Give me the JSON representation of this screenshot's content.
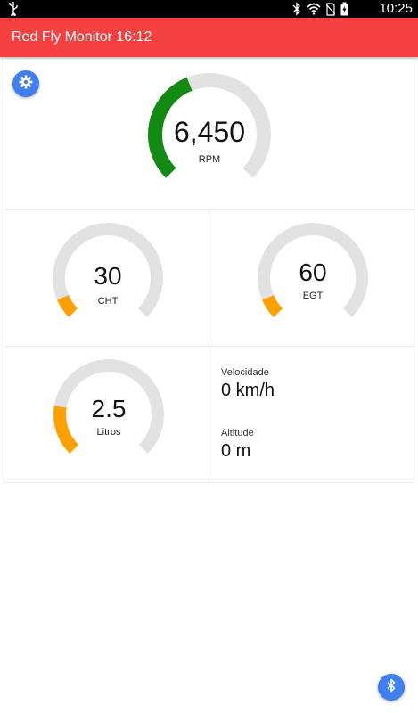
{
  "status_bar": {
    "time": "10:25",
    "icons": [
      "usb-icon",
      "bluetooth-icon",
      "wifi-icon",
      "no-sim-icon",
      "battery-charging-icon"
    ]
  },
  "app_bar": {
    "title": "Red Fly Monitor 16:12"
  },
  "colors": {
    "app_bar": "#f44040",
    "fab": "#3f7ff0",
    "gauge_track": "#e2e2e2",
    "rpm_arc": "#138a13",
    "orange_arc": "#ffa000"
  },
  "gauges": {
    "rpm": {
      "value": "6,450",
      "label": "RPM",
      "fill_fraction": 0.42
    },
    "cht": {
      "value": "30",
      "label": "CHT",
      "fill_fraction": 0.08
    },
    "egt": {
      "value": "60",
      "label": "EGT",
      "fill_fraction": 0.08
    },
    "fuel": {
      "value": "2.5",
      "label": "Litros",
      "fill_fraction": 0.2
    }
  },
  "info": {
    "speed": {
      "label": "Velocidade",
      "value": "0 km/h"
    },
    "altitude": {
      "label": "Altitude",
      "value": "0 m"
    }
  },
  "buttons": {
    "settings": "gear-icon",
    "bluetooth": "bluetooth-icon"
  }
}
